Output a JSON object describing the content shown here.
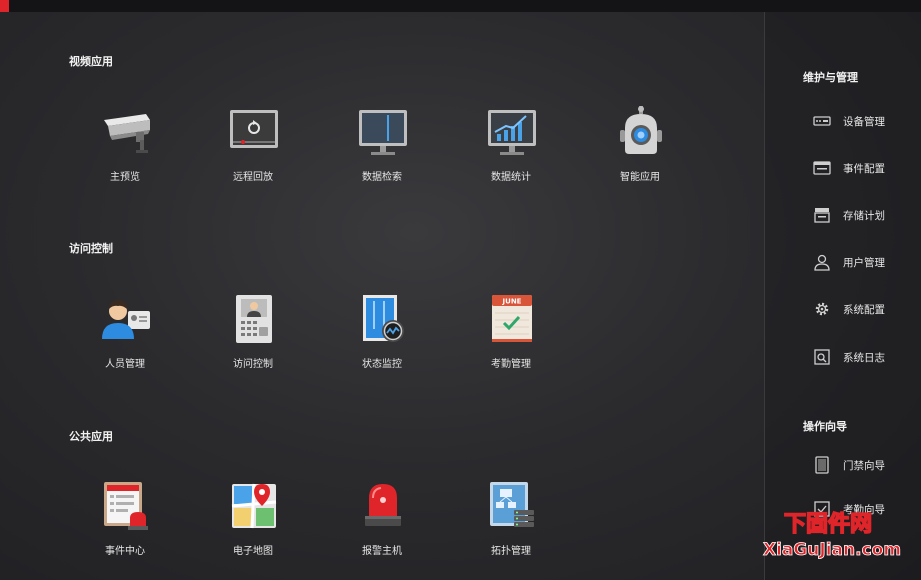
{
  "sections": {
    "video": {
      "title": "视频应用",
      "apps": [
        "主预览",
        "远程回放",
        "数据检索",
        "数据统计",
        "智能应用"
      ]
    },
    "access": {
      "title": "访问控制",
      "apps": [
        "人员管理",
        "访问控制",
        "状态监控",
        "考勤管理"
      ]
    },
    "public": {
      "title": "公共应用",
      "apps": [
        "事件中心",
        "电子地图",
        "报警主机",
        "拓扑管理"
      ]
    }
  },
  "calendar_month": "JUNE",
  "sidebar": {
    "maintenance_title": "维护与管理",
    "maintenance_items": [
      "设备管理",
      "事件配置",
      "存储计划",
      "用户管理",
      "系统配置",
      "系统日志"
    ],
    "wizard_title": "操作向导",
    "wizard_items": [
      "门禁向导",
      "考勤向导"
    ]
  },
  "watermark": {
    "top": "下固件网",
    "bottom": "XiaGuJian.com"
  },
  "colors": {
    "accent": "#e0252a",
    "background": "#2b2b2e",
    "text": "#e6e6e6"
  }
}
